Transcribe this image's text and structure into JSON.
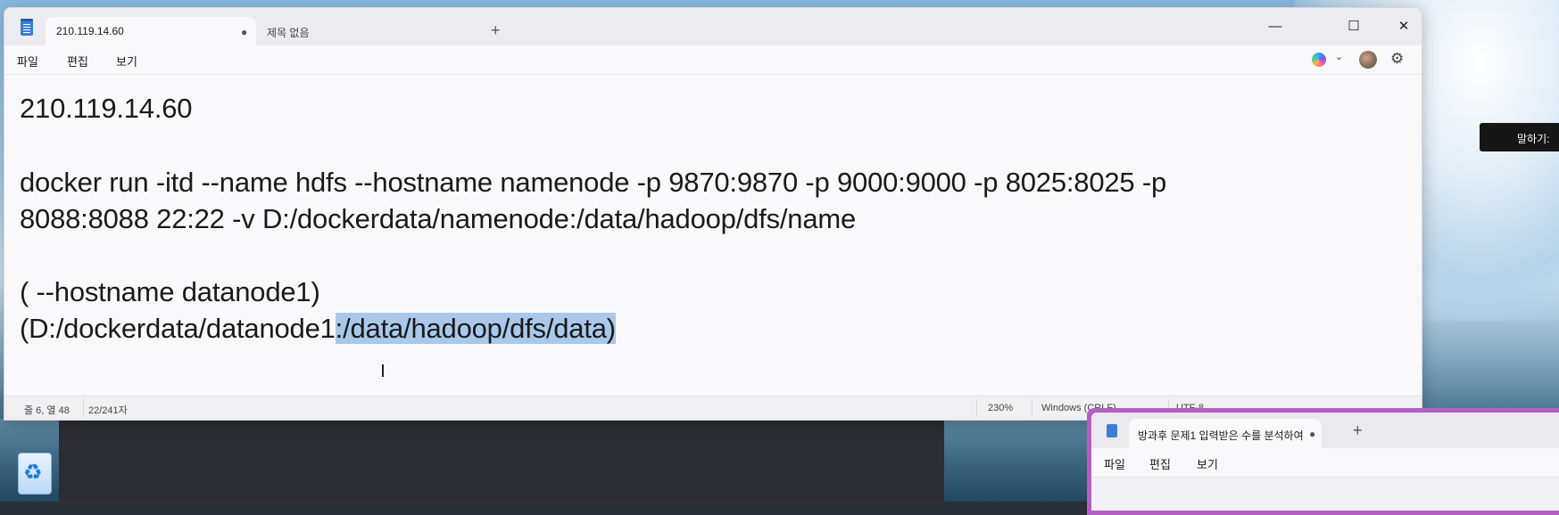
{
  "main_window": {
    "tabs": [
      {
        "label": "210.119.14.60",
        "unsaved_marker": "●"
      },
      {
        "label": "제목 없음"
      }
    ],
    "new_tab_symbol": "+",
    "window_controls": {
      "minimize": "—",
      "maximize": "☐",
      "close": "✕"
    },
    "menu": [
      "파일",
      "편집",
      "보기"
    ],
    "toolbar_right": {
      "copilot_chevron": "⌄",
      "settings_glyph": "⚙"
    },
    "editor": {
      "lines": [
        "210.119.14.60",
        "",
        "docker run -itd --name hdfs --hostname namenode -p 9870:9870 -p 9000:9000 -p 8025:8025 -p",
        "8088:8088 22:22 -v D:/dockerdata/namenode:/data/hadoop/dfs/name",
        "",
        "( --hostname datanode1)"
      ],
      "last_line_prefix": "(D:/dockerdata/datanode1",
      "last_line_selected": ":/data/hadoop/dfs/data)"
    },
    "status": {
      "position": "줄 6, 열 48",
      "char_count": "22/241자",
      "zoom": "230%",
      "line_ending": "Windows (CRLF)",
      "encoding": "UTF-8"
    }
  },
  "speak_tooltip": "말하기:",
  "second_window": {
    "tab_label": "방과후 문제1 입력받은 수를 분석하여",
    "unsaved_marker": "●",
    "new_tab_symbol": "+",
    "menu": [
      "파일",
      "편집",
      "보기"
    ]
  },
  "desktop": {
    "recycle_bin_icon": "recycle-bin-icon"
  }
}
